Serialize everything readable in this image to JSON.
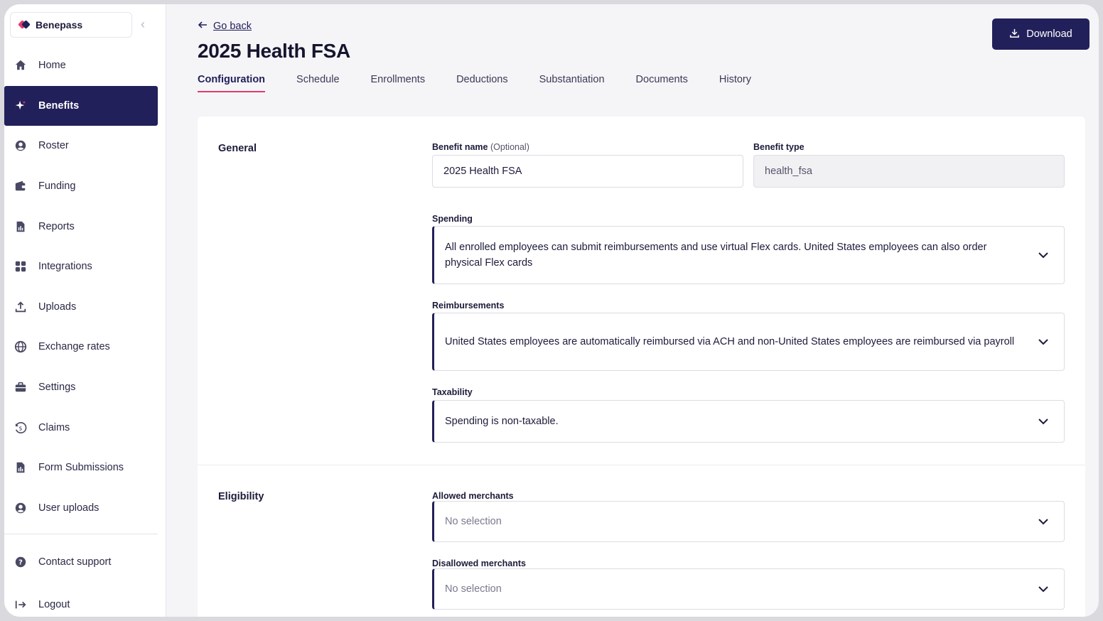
{
  "brand": {
    "name": "Benepass"
  },
  "sidebar": {
    "items": [
      {
        "label": "Home",
        "icon": "home-icon"
      },
      {
        "label": "Benefits",
        "icon": "sparkle-icon",
        "active": true
      },
      {
        "label": "Roster",
        "icon": "user-circle-icon"
      },
      {
        "label": "Funding",
        "icon": "wallet-icon"
      },
      {
        "label": "Reports",
        "icon": "report-icon"
      },
      {
        "label": "Integrations",
        "icon": "grid-icon"
      },
      {
        "label": "Uploads",
        "icon": "upload-icon"
      },
      {
        "label": "Exchange rates",
        "icon": "globe-icon"
      },
      {
        "label": "Settings",
        "icon": "briefcase-icon"
      },
      {
        "label": "Claims",
        "icon": "dollar-circle-icon"
      },
      {
        "label": "Form Submissions",
        "icon": "report-icon"
      },
      {
        "label": "User uploads",
        "icon": "user-circle-icon"
      }
    ],
    "footer": [
      {
        "label": "Contact support",
        "icon": "help-icon"
      },
      {
        "label": "Logout",
        "icon": "logout-icon"
      }
    ]
  },
  "header": {
    "back_label": "Go back",
    "title": "2025 Health FSA",
    "download_label": "Download"
  },
  "tabs": [
    {
      "label": "Configuration",
      "active": true
    },
    {
      "label": "Schedule"
    },
    {
      "label": "Enrollments"
    },
    {
      "label": "Deductions"
    },
    {
      "label": "Substantiation"
    },
    {
      "label": "Documents"
    },
    {
      "label": "History"
    }
  ],
  "general": {
    "section_title": "General",
    "benefit_name_label": "Benefit name",
    "benefit_name_optional": "(Optional)",
    "benefit_name_value": "2025 Health FSA",
    "benefit_type_label": "Benefit type",
    "benefit_type_value": "health_fsa",
    "spending_label": "Spending",
    "spending_value": "All enrolled employees can submit reimbursements and use virtual Flex cards. United States employees can also order physical Flex cards",
    "reimbursements_label": "Reimbursements",
    "reimbursements_value": "United States employees are automatically reimbursed via ACH and non-United States employees are reimbursed via payroll",
    "taxability_label": "Taxability",
    "taxability_value": "Spending is non-taxable."
  },
  "eligibility": {
    "section_title": "Eligibility",
    "allowed_label": "Allowed merchants",
    "allowed_value": "No selection",
    "disallowed_label": "Disallowed merchants",
    "disallowed_value": "No selection"
  },
  "colors": {
    "primary": "#22205a",
    "accent": "#e23a6a",
    "background": "#f5f5f8"
  }
}
